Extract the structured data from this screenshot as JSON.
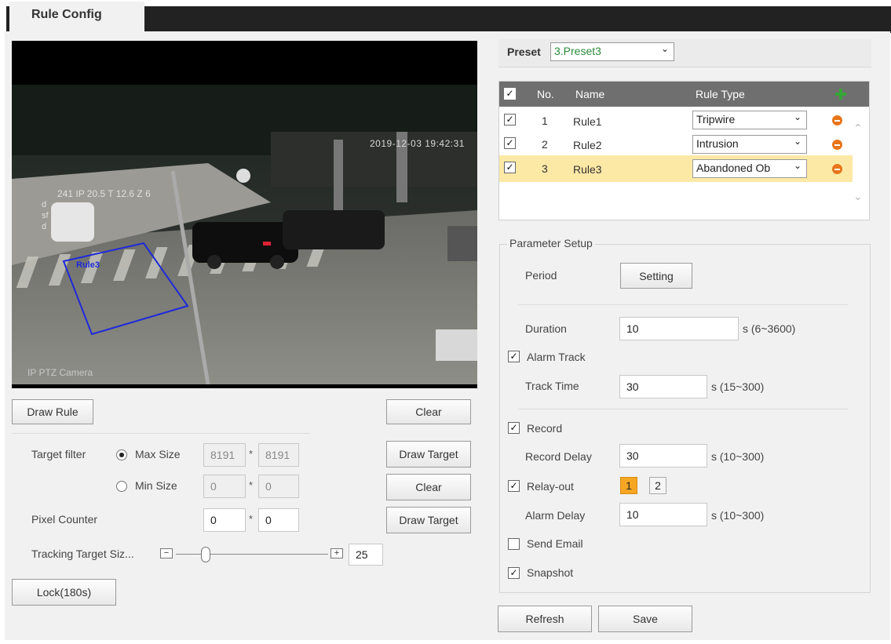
{
  "tab": {
    "title": "Rule Config"
  },
  "video": {
    "timestamp": "2019-12-03 19:42:31",
    "osd_line": "241 IP 20.5 T 12.6 Z 6",
    "osd_side": "dsfd",
    "camera_name": "IP PTZ Camera",
    "rule_label": "Rule3"
  },
  "left": {
    "draw_rule": "Draw Rule",
    "clear_1": "Clear",
    "target_filter_label": "Target filter",
    "max_size_label": "Max Size",
    "min_size_label": "Min Size",
    "max_w": "8191",
    "max_h": "8191",
    "min_w": "0",
    "min_h": "0",
    "times": "*",
    "draw_target_1": "Draw Target",
    "clear_2": "Clear",
    "pixel_counter_label": "Pixel Counter",
    "pixel_w": "0",
    "pixel_h": "0",
    "draw_target_2": "Draw Target",
    "tracking_label": "Tracking Target Siz...",
    "tracking_value": "25",
    "tracking_level": 25,
    "minus": "−",
    "plus": "+",
    "lock": "Lock(180s)"
  },
  "preset": {
    "label": "Preset",
    "value": "3.Preset3"
  },
  "rules": {
    "headers": {
      "no": "No.",
      "name": "Name",
      "type": "Rule Type"
    },
    "rows": [
      {
        "no": "1",
        "name": "Rule1",
        "type": "Tripwire",
        "checked": true
      },
      {
        "no": "2",
        "name": "Rule2",
        "type": "Intrusion",
        "checked": true
      },
      {
        "no": "3",
        "name": "Rule3",
        "type": "Abandoned Ob",
        "checked": true
      }
    ]
  },
  "params": {
    "legend": "Parameter Setup",
    "period_label": "Period",
    "setting_button": "Setting",
    "duration_label": "Duration",
    "duration_value": "10",
    "duration_range": "s (6~3600)",
    "alarm_track_label": "Alarm Track",
    "track_time_label": "Track Time",
    "track_time_value": "30",
    "track_time_range": "s (15~300)",
    "record_label": "Record",
    "record_delay_label": "Record Delay",
    "record_delay_value": "30",
    "record_delay_range": "s (10~300)",
    "relay_label": "Relay-out",
    "relay_1": "1",
    "relay_2": "2",
    "alarm_delay_label": "Alarm Delay",
    "alarm_delay_value": "10",
    "alarm_delay_range": "s (10~300)",
    "send_email_label": "Send Email",
    "snapshot_label": "Snapshot"
  },
  "footer": {
    "refresh": "Refresh",
    "save": "Save"
  },
  "colors": {
    "accent": "#f5a623",
    "highlight_row": "#fde9a6",
    "rule_box": "#1e2ad8"
  }
}
